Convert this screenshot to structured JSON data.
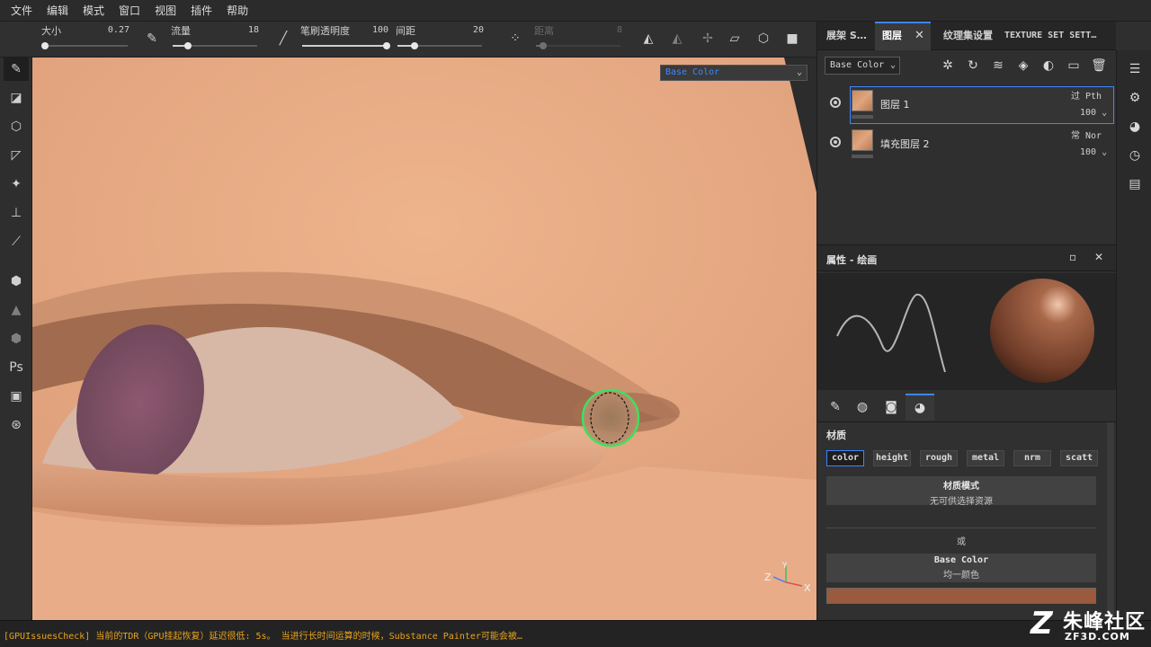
{
  "menu": [
    "文件",
    "编辑",
    "模式",
    "窗口",
    "视图",
    "插件",
    "帮助"
  ],
  "toolbar": {
    "size": {
      "label": "大小",
      "value": "0.27",
      "level": 0.02
    },
    "flow": {
      "label": "流量",
      "value": "18",
      "level": 0.18
    },
    "opacity": {
      "label": "笔刷透明度",
      "value": "100",
      "level": 1.0
    },
    "spacing": {
      "label": "间距",
      "value": "20",
      "level": 0.2
    },
    "distance": {
      "label": "距离",
      "value": "8",
      "level": 0.08
    }
  },
  "viewport": {
    "channel": "Base Color",
    "axis": {
      "z": "Z",
      "y": "Y",
      "x": "X"
    }
  },
  "tabs": {
    "shelf": "展架 S…",
    "layers": "图层",
    "texture_set": "纹理集设置",
    "texture_set_settings": "TEXTURE SET SETT…"
  },
  "layer_panel": {
    "channel": "Base Color",
    "layers": [
      {
        "name": "图层 1",
        "blend": "过 Pth",
        "opacity": "100",
        "selected": true
      },
      {
        "name": "填充图层 2",
        "blend": "常 Nor",
        "opacity": "100",
        "selected": false
      }
    ]
  },
  "properties": {
    "title": "属性 - 绘画"
  },
  "material": {
    "title": "材质",
    "channels": [
      "color",
      "height",
      "rough",
      "metal",
      "nrm",
      "scatt"
    ],
    "active_channel": "color",
    "material_mode_label": "材质模式",
    "material_mode_value": "无可供选择资源",
    "or_text": "或",
    "base_color_label": "Base Color",
    "base_color_value": "均一颜色",
    "base_color_hex": "#9a5a3e"
  },
  "status": "[GPUIssuesCheck] 当前的TDR（GPU挂起恢复）延迟很低: 5s。 当进行长时间运算的时候，Substance Painter可能会被…",
  "watermark": {
    "logo": "Z",
    "name": "朱峰社区",
    "url": "ZF3D.COM"
  },
  "colors": {
    "accent": "#3d86ff",
    "status": "#e8a31c",
    "brush_ring": "#3fe060",
    "skin": "#e3a47e"
  }
}
